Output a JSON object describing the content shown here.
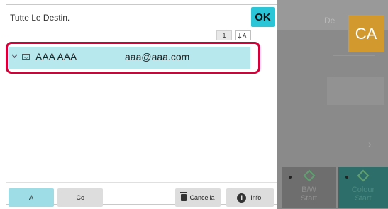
{
  "dialog": {
    "title": "Tutte Le Destin.",
    "ok_label": "OK",
    "count": "1",
    "sort_icon": "sort-az-icon"
  },
  "selected_entry": {
    "name": "AAA AAA",
    "email": "aaa@aaa.com"
  },
  "bottom_bar": {
    "tab_a": "A",
    "tab_cc": "Cc",
    "cancel_label": "Cancella",
    "info_label": "Info."
  },
  "side": {
    "ca_label": "CA",
    "ghost_title": "De",
    "bw_label_1": "B/W",
    "bw_label_2": "Start",
    "colour_label_1": "Colour",
    "colour_label_2": "Start"
  },
  "colors": {
    "accent": "#2ac5d6",
    "row_highlight": "#b6e8ee",
    "callout_red": "#d5003a",
    "ca_orange": "#d29a2e"
  }
}
